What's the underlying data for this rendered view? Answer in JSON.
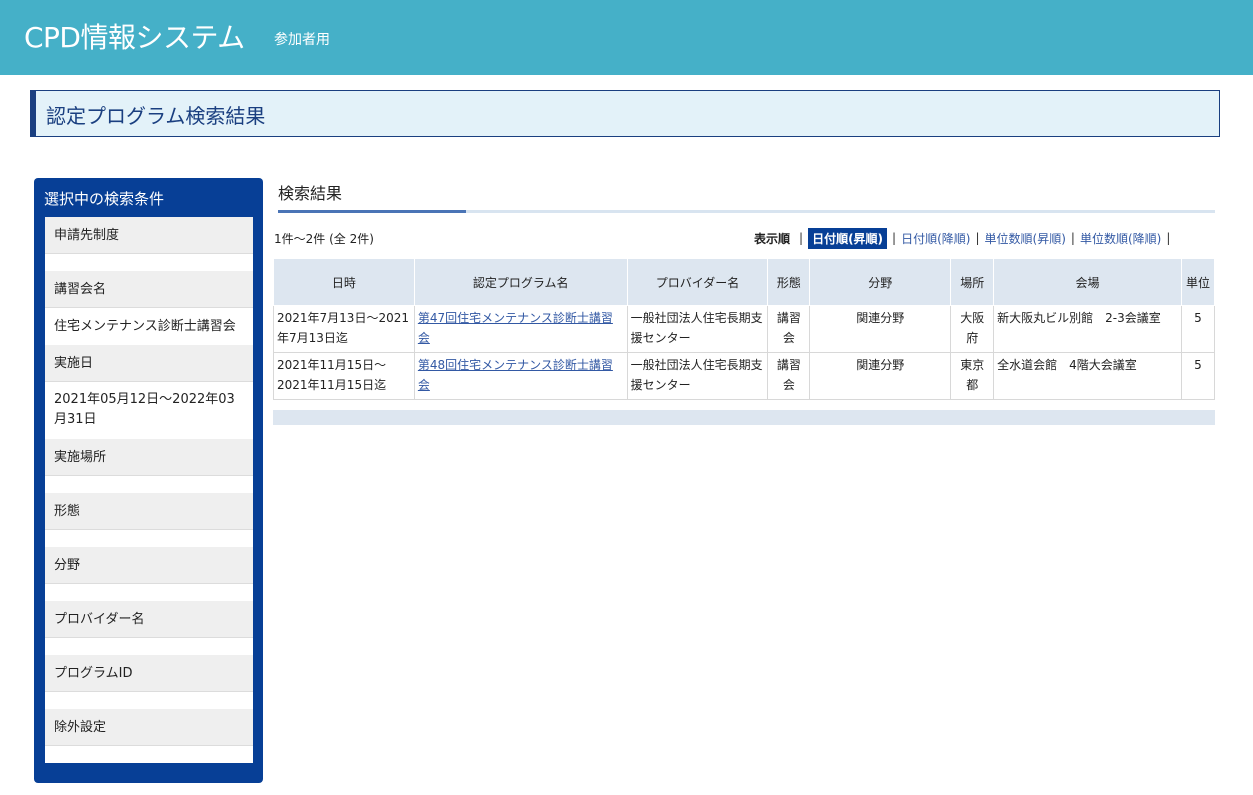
{
  "header": {
    "title": "CPD情報システム",
    "subtitle": "参加者用"
  },
  "page": {
    "heading": "認定プログラム検索結果"
  },
  "sidebar": {
    "title": "選択中の検索条件",
    "rows": [
      {
        "label": "申請先制度",
        "value": ""
      },
      {
        "label": "講習会名",
        "value": "住宅メンテナンス診断士講習会"
      },
      {
        "label": "実施日",
        "value": "2021年05月12日～2022年03月31日"
      },
      {
        "label": "実施場所",
        "value": ""
      },
      {
        "label": "形態",
        "value": ""
      },
      {
        "label": "分野",
        "value": ""
      },
      {
        "label": "プロバイダー名",
        "value": ""
      },
      {
        "label": "プログラムID",
        "value": ""
      },
      {
        "label": "除外設定",
        "value": ""
      }
    ]
  },
  "results": {
    "title": "検索結果",
    "count": "1件～2件 (全 2件)",
    "sort_label": "表示順",
    "sort_options": [
      "日付順(昇順)",
      "日付順(降順)",
      "単位数順(昇順)",
      "単位数順(降順)"
    ],
    "sort_selected": "日付順(昇順)",
    "columns": [
      "日時",
      "認定プログラム名",
      "プロバイダー名",
      "形態",
      "分野",
      "場所",
      "会場",
      "単位"
    ],
    "rows": [
      {
        "date": "2021年7月13日～2021年7月13日迄",
        "program": "第47回住宅メンテナンス診断士講習会",
        "provider": "一般社団法人住宅長期支援センター",
        "form": "講習会",
        "field": "関連分野",
        "place": "大阪府",
        "venue": "新大阪丸ビル別館　2-3会議室",
        "units": "5"
      },
      {
        "date": "2021年11月15日～2021年11月15日迄",
        "program": "第48回住宅メンテナンス診断士講習会",
        "provider": "一般社団法人住宅長期支援センター",
        "form": "講習会",
        "field": "関連分野",
        "place": "東京都",
        "venue": "全水道会館　4階大会議室",
        "units": "5"
      }
    ]
  },
  "colors": {
    "header": "#45b0c8",
    "sidebar": "#073f96",
    "accent": "#1a3f80",
    "link": "#3359a4"
  }
}
